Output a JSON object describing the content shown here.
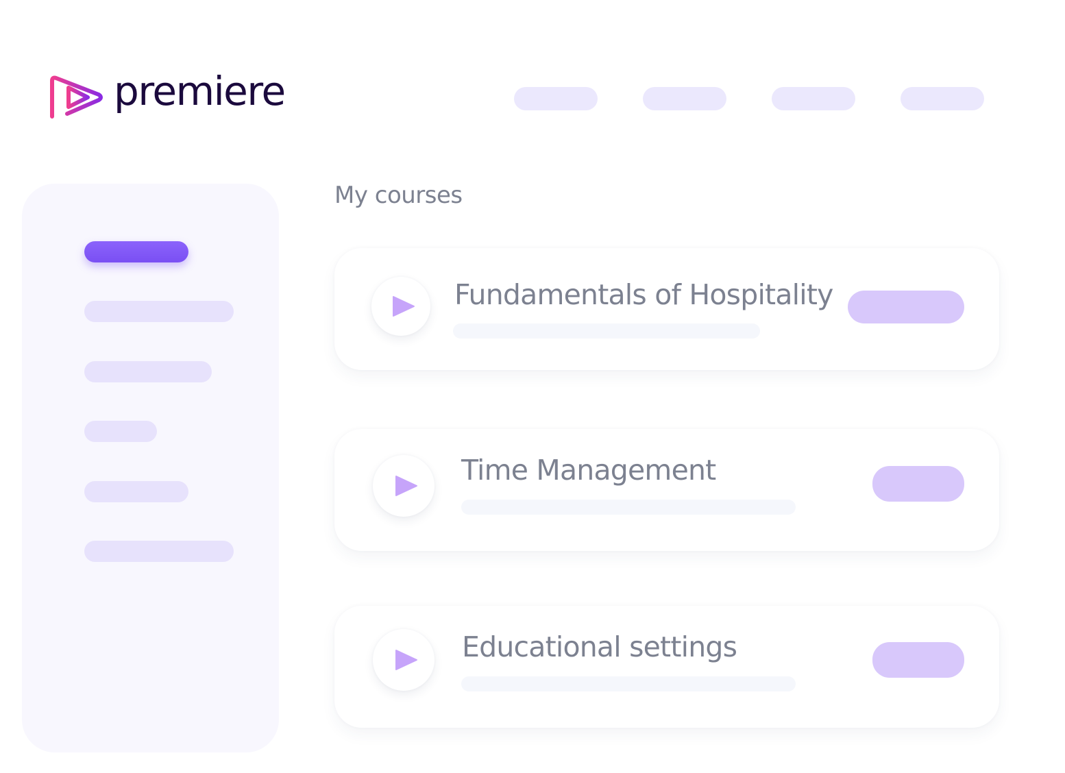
{
  "brand": {
    "name": "premiere",
    "colors": {
      "wordmark": "#1b0a3d",
      "mark_gradient_start": "#ef3d8f",
      "mark_gradient_end": "#8a2be2"
    }
  },
  "top_nav": {
    "items": [
      {
        "label": ""
      },
      {
        "label": ""
      },
      {
        "label": ""
      },
      {
        "label": ""
      }
    ]
  },
  "sidebar": {
    "items": [
      {
        "label": "",
        "active": true
      },
      {
        "label": "",
        "active": false
      },
      {
        "label": "",
        "active": false
      },
      {
        "label": "",
        "active": false
      },
      {
        "label": "",
        "active": false
      },
      {
        "label": "",
        "active": false
      }
    ]
  },
  "main": {
    "section_title": "My courses",
    "courses": [
      {
        "title": "Fundamentals of Hospitality",
        "icon": "play-icon"
      },
      {
        "title": "Time Management",
        "icon": "play-icon"
      },
      {
        "title": "Educational settings",
        "icon": "play-icon"
      }
    ]
  },
  "colors": {
    "accent": "#7a4ff3",
    "placeholder": "#ebe8fd",
    "action_pill": "#d8c8fb",
    "text_muted": "#7c8190",
    "play_icon": "#c6a4fa"
  }
}
